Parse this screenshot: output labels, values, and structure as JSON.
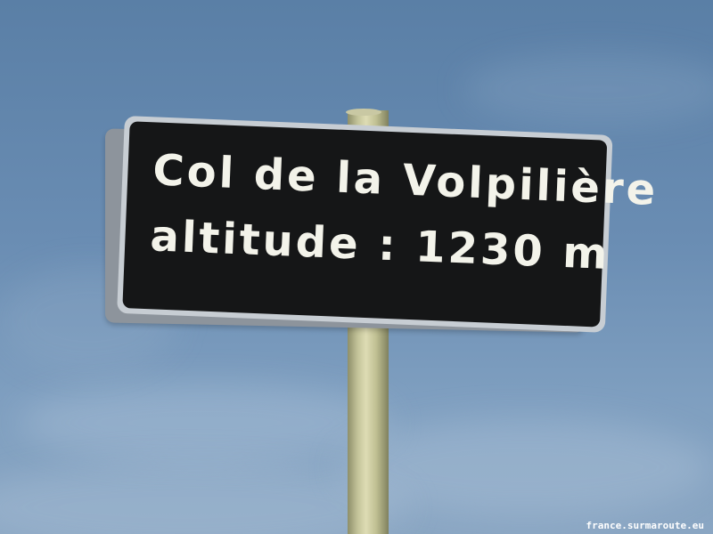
{
  "sign": {
    "line1": "Col de la Volpilière",
    "line2": "altitude : 1230 m"
  },
  "watermark": "france.surmaroute.eu",
  "colors": {
    "sky": "#6a8db3",
    "sign_face": "#151617",
    "sign_text": "#f3f3ea",
    "pole": "#c4c49a"
  }
}
